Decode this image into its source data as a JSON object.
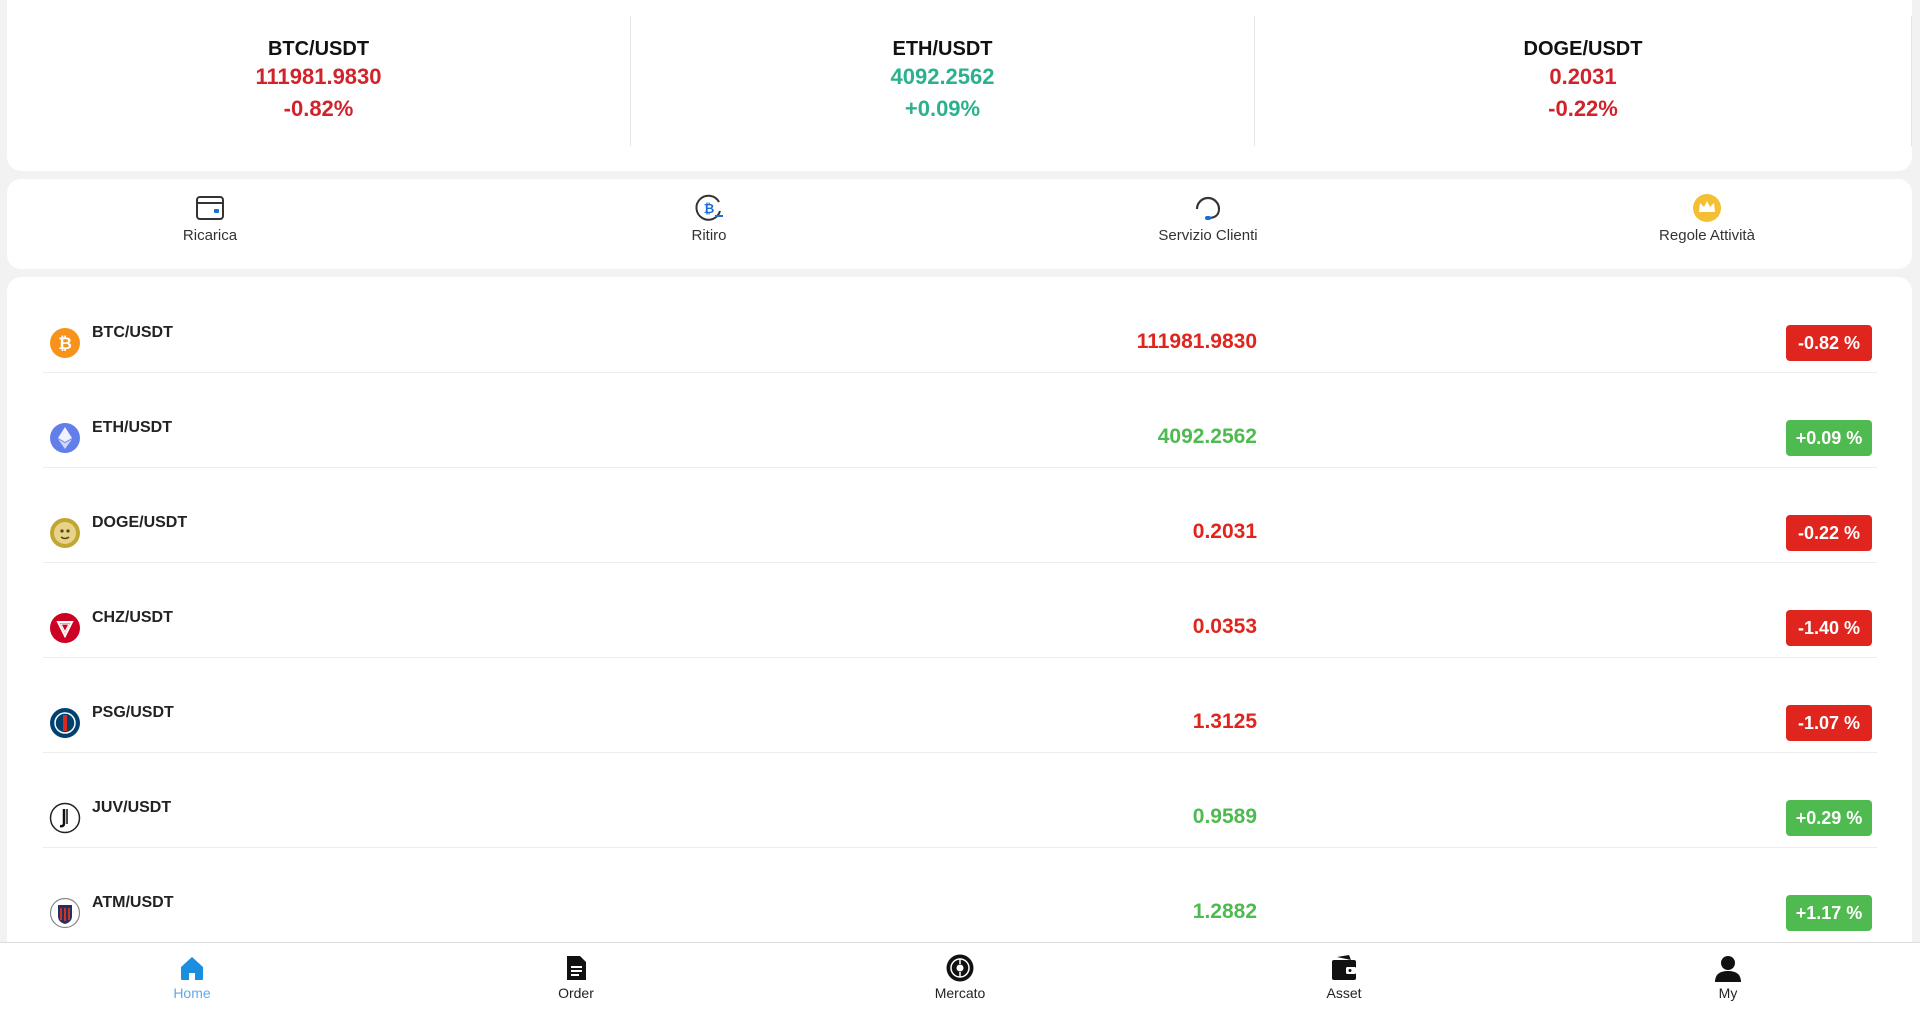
{
  "colors": {
    "up": "#2bb18e",
    "down": "#d0232b",
    "list_up": "#4fba4f",
    "list_down": "#e0251f",
    "accent": "#1a8fe0"
  },
  "tickers": [
    {
      "pair": "BTC/USDT",
      "price": "111981.9830",
      "change": "-0.82%",
      "direction": "down"
    },
    {
      "pair": "ETH/USDT",
      "price": "4092.2562",
      "change": "+0.09%",
      "direction": "up"
    },
    {
      "pair": "DOGE/USDT",
      "price": "0.2031",
      "change": "-0.22%",
      "direction": "down"
    }
  ],
  "actions": [
    {
      "label": "Ricarica",
      "icon": "wallet-icon"
    },
    {
      "label": "Ritiro",
      "icon": "bitcoin-withdraw-icon"
    },
    {
      "label": "Servizio Clienti",
      "icon": "headset-icon"
    },
    {
      "label": "Regole Attività",
      "icon": "crown-icon"
    }
  ],
  "market": [
    {
      "pair": "BTC/USDT",
      "price": "111981.9830",
      "change": "-0.82 %",
      "direction": "down",
      "icon": "bitcoin-icon"
    },
    {
      "pair": "ETH/USDT",
      "price": "4092.2562",
      "change": "+0.09 %",
      "direction": "up",
      "icon": "ethereum-icon"
    },
    {
      "pair": "DOGE/USDT",
      "price": "0.2031",
      "change": "-0.22 %",
      "direction": "down",
      "icon": "dogecoin-icon"
    },
    {
      "pair": "CHZ/USDT",
      "price": "0.0353",
      "change": "-1.40 %",
      "direction": "down",
      "icon": "chiliz-icon"
    },
    {
      "pair": "PSG/USDT",
      "price": "1.3125",
      "change": "-1.07 %",
      "direction": "down",
      "icon": "psg-icon"
    },
    {
      "pair": "JUV/USDT",
      "price": "0.9589",
      "change": "+0.29 %",
      "direction": "up",
      "icon": "juventus-icon"
    },
    {
      "pair": "ATM/USDT",
      "price": "1.2882",
      "change": "+1.17 %",
      "direction": "up",
      "icon": "atletico-icon"
    }
  ],
  "nav": [
    {
      "label": "Home",
      "icon": "home-icon",
      "active": true
    },
    {
      "label": "Order",
      "icon": "document-icon",
      "active": false
    },
    {
      "label": "Mercato",
      "icon": "market-icon",
      "active": false
    },
    {
      "label": "Asset",
      "icon": "wallet-icon",
      "active": false
    },
    {
      "label": "My",
      "icon": "user-icon",
      "active": false
    }
  ]
}
